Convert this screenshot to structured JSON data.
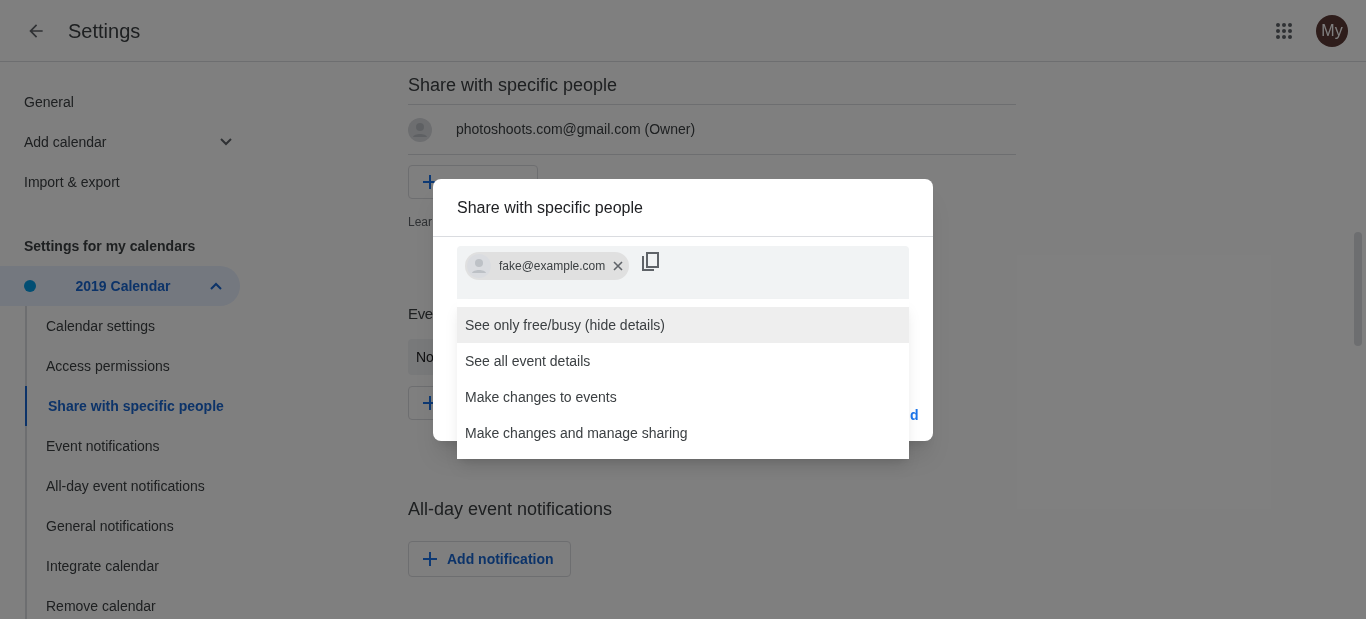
{
  "header": {
    "title": "Settings",
    "avatar_initials": "My"
  },
  "sidebar": {
    "items": [
      {
        "label": "General"
      },
      {
        "label": "Add calendar",
        "expanded": false
      },
      {
        "label": "Import & export"
      }
    ],
    "section_title": "Settings for my calendars",
    "calendars": [
      {
        "name": "2019 Calendar",
        "color": "#024e73",
        "expanded": true,
        "selected": true,
        "children": [
          {
            "label": "Calendar settings",
            "selected": false
          },
          {
            "label": "Access permissions",
            "selected": false
          },
          {
            "label": "Share with specific people",
            "selected": true
          },
          {
            "label": "Event notifications",
            "selected": false
          },
          {
            "label": "All-day event notifications",
            "selected": false
          },
          {
            "label": "General notifications",
            "selected": false
          },
          {
            "label": "Integrate calendar",
            "selected": false
          },
          {
            "label": "Remove calendar",
            "selected": false
          }
        ]
      }
    ]
  },
  "main": {
    "share_section": {
      "title": "Share with specific people",
      "people": [
        {
          "email": "photoshoots.com@gmail.com (Owner)"
        }
      ],
      "learn_fragment": "Lear"
    },
    "event_section": {
      "title_fragment": "Eve",
      "select_fragment": "No"
    },
    "allday_section": {
      "title": "All-day event notifications",
      "button": "Add notification"
    }
  },
  "dialog": {
    "title": "Share with specific people",
    "chips": [
      {
        "email": "fake@example.com"
      }
    ],
    "menu": [
      {
        "label": "See only free/busy (hide details)",
        "highlighted": true
      },
      {
        "label": "See all event details",
        "highlighted": false
      },
      {
        "label": "Make changes to events",
        "highlighted": false
      },
      {
        "label": "Make changes and manage sharing",
        "highlighted": false
      }
    ],
    "link_fragment": "d"
  }
}
